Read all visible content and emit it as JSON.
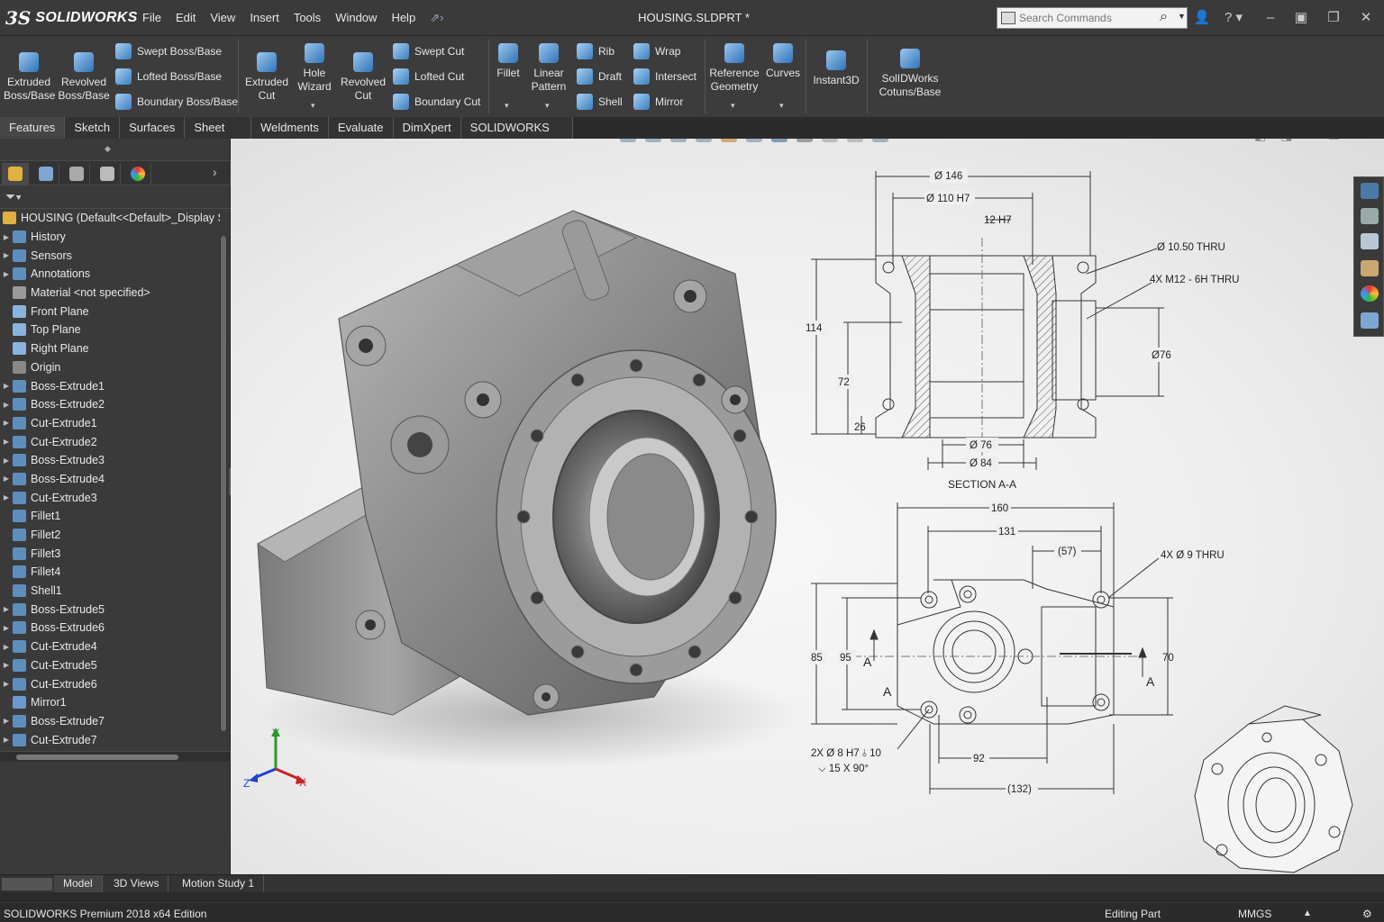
{
  "app": {
    "logo_prefix": "3S",
    "logo_name": "SOLIDWORKS",
    "document_title": "HOUSING.SLDPRT *"
  },
  "menu": [
    "File",
    "Edit",
    "View",
    "Insert",
    "Tools",
    "Window",
    "Help"
  ],
  "search": {
    "placeholder": "Search Commands"
  },
  "ribbon": {
    "extruded_boss": "Extruded Boss/Base",
    "revolved_boss": "Revolved Boss/Base",
    "swept_boss": "Swept Boss/Base",
    "lofted_boss": "Lofted Boss/Base",
    "boundary_boss": "Boundary Boss/Base",
    "extruded_cut": "Extruded Cut",
    "hole_wizard": "Hole Wizard",
    "revolved_cut": "Revolved Cut",
    "swept_cut": "Swept Cut",
    "lofted_cut": "Lofted Cut",
    "boundary_cut": "Boundary Cut",
    "fillet": "Fillet",
    "linear_pattern": "Linear Pattern",
    "rib": "Rib",
    "draft": "Draft",
    "shell": "Shell",
    "wrap": "Wrap",
    "intersect": "Intersect",
    "mirror": "Mirror",
    "reference_geometry": "Reference Geometry",
    "curves": "Curves",
    "instant3d": "Instant3D",
    "addin_line1": "SolIDWorks",
    "addin_line2": "Cotuns/Base"
  },
  "command_tabs": [
    "Features",
    "Sketch",
    "Surfaces",
    "Sheet Metal",
    "Weldments",
    "Evaluate",
    "DimXpert",
    "SOLIDWORKS Add-Ins"
  ],
  "feature_tree": {
    "root": "HOUSING  (Default<<Default>_Display State",
    "items": [
      {
        "label": "History",
        "kind": "folder",
        "expandable": true
      },
      {
        "label": "Sensors",
        "kind": "folder",
        "expandable": true
      },
      {
        "label": "Annotations",
        "kind": "folder",
        "expandable": true
      },
      {
        "label": "Material <not specified>",
        "kind": "material",
        "expandable": false
      },
      {
        "label": "Front Plane",
        "kind": "plane",
        "expandable": false
      },
      {
        "label": "Top Plane",
        "kind": "plane",
        "expandable": false
      },
      {
        "label": "Right Plane",
        "kind": "plane",
        "expandable": false
      },
      {
        "label": "Origin",
        "kind": "origin",
        "expandable": false
      },
      {
        "label": "Boss-Extrude1",
        "kind": "feature",
        "expandable": true
      },
      {
        "label": "Boss-Extrude2",
        "kind": "feature",
        "expandable": true
      },
      {
        "label": "Cut-Extrude1",
        "kind": "feature",
        "expandable": true
      },
      {
        "label": "Cut-Extrude2",
        "kind": "feature",
        "expandable": true
      },
      {
        "label": "Boss-Extrude3",
        "kind": "feature",
        "expandable": true
      },
      {
        "label": "Boss-Extrude4",
        "kind": "feature",
        "expandable": true
      },
      {
        "label": "Cut-Extrude3",
        "kind": "feature",
        "expandable": true
      },
      {
        "label": "Fillet1",
        "kind": "feature",
        "expandable": false
      },
      {
        "label": "Fillet2",
        "kind": "feature",
        "expandable": false
      },
      {
        "label": "Fillet3",
        "kind": "feature",
        "expandable": false
      },
      {
        "label": "Fillet4",
        "kind": "feature",
        "expandable": false
      },
      {
        "label": "Shell1",
        "kind": "feature",
        "expandable": false
      },
      {
        "label": "Boss-Extrude5",
        "kind": "feature",
        "expandable": true
      },
      {
        "label": "Boss-Extrude6",
        "kind": "feature",
        "expandable": true
      },
      {
        "label": "Cut-Extrude4",
        "kind": "feature",
        "expandable": true
      },
      {
        "label": "Cut-Extrude5",
        "kind": "feature",
        "expandable": true
      },
      {
        "label": "Cut-Extrude6",
        "kind": "feature",
        "expandable": true
      },
      {
        "label": "Mirror1",
        "kind": "mirror",
        "expandable": false
      },
      {
        "label": "Boss-Extrude7",
        "kind": "feature",
        "expandable": true
      },
      {
        "label": "Cut-Extrude7",
        "kind": "feature",
        "expandable": true
      }
    ]
  },
  "triad": {
    "x": "X",
    "y": "Y",
    "z": "Z"
  },
  "drawing": {
    "section_label": "SECTION A-A",
    "section_dims": {
      "d146": "Ø 146",
      "d110": "Ø 110 H7",
      "h12": "12 H7",
      "thru1050": "Ø 10.50 THRU",
      "m12": "4X M12 - 6H THRU",
      "h114": "114",
      "h72": "72",
      "h26": "26",
      "d76r": "Ø76",
      "d76": "Ø 76",
      "d84": "Ø 84"
    },
    "front_dims": {
      "w160": "160",
      "w131": "131",
      "w57": "(57)",
      "thru9": "4X Ø 9 THRU",
      "h85": "85",
      "h95": "95",
      "h70": "70",
      "secA": "A",
      "w92": "92",
      "w132": "(132)",
      "hole_a": "2X Ø 8 H7 ⫰ 10",
      "hole_b": "⌵ 15 X 90°"
    }
  },
  "bottom_tabs": [
    "Model",
    "3D Views",
    "Motion Study 1"
  ],
  "status": {
    "edition": "SOLIDWORKS Premium 2018 x64 Edition",
    "mode": "Editing Part",
    "units": "MMGS"
  },
  "colors": {
    "accent_blue": "#3a7fc0",
    "panel_bg": "#3a3a3a",
    "viewport_bg": "#efefef"
  }
}
